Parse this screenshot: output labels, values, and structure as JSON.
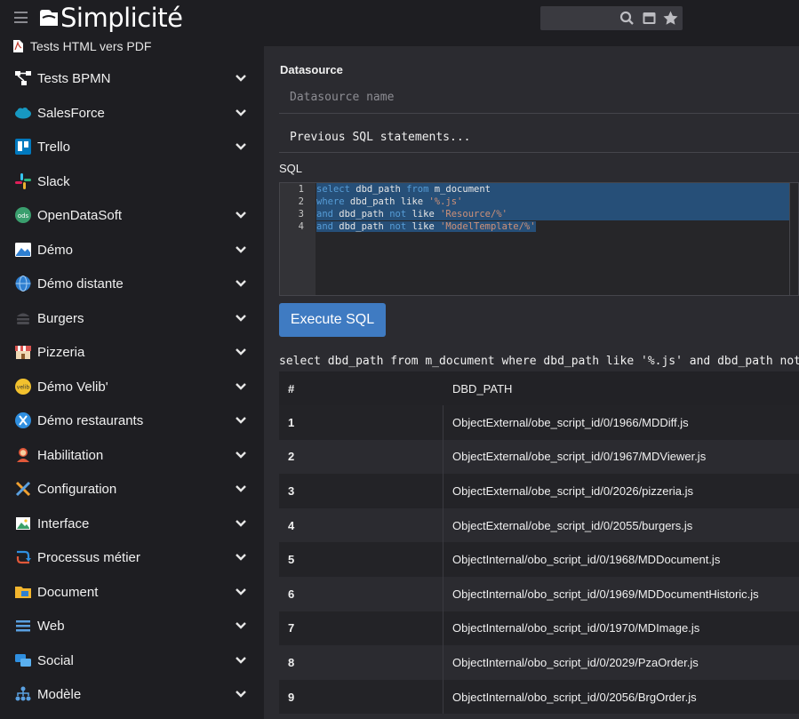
{
  "app": {
    "logo_text": "Simplicité"
  },
  "search": {
    "placeholder": ""
  },
  "sidebar": {
    "current": "Tests HTML vers PDF",
    "items": [
      {
        "label": "Tests BPMN",
        "icon": "bpmn-icon",
        "expandable": true
      },
      {
        "label": "SalesForce",
        "icon": "salesforce-icon",
        "expandable": true
      },
      {
        "label": "Trello",
        "icon": "trello-icon",
        "expandable": true
      },
      {
        "label": "Slack",
        "icon": "slack-icon",
        "expandable": false
      },
      {
        "label": "OpenDataSoft",
        "icon": "opendatasoft-icon",
        "expandable": true
      },
      {
        "label": "Démo",
        "icon": "demo-icon",
        "expandable": true
      },
      {
        "label": "Démo distante",
        "icon": "globe-icon",
        "expandable": true
      },
      {
        "label": "Burgers",
        "icon": "burger-icon",
        "expandable": true
      },
      {
        "label": "Pizzeria",
        "icon": "shop-icon",
        "expandable": true
      },
      {
        "label": "Démo Velib'",
        "icon": "velib-icon",
        "expandable": true
      },
      {
        "label": "Démo restaurants",
        "icon": "restaurant-icon",
        "expandable": true
      },
      {
        "label": "Habilitation",
        "icon": "user-icon",
        "expandable": true
      },
      {
        "label": "Configuration",
        "icon": "tools-icon",
        "expandable": true
      },
      {
        "label": "Interface",
        "icon": "image-icon",
        "expandable": true
      },
      {
        "label": "Processus métier",
        "icon": "process-icon",
        "expandable": true
      },
      {
        "label": "Document",
        "icon": "folder-icon",
        "expandable": true
      },
      {
        "label": "Web",
        "icon": "web-icon",
        "expandable": true
      },
      {
        "label": "Social",
        "icon": "chat-icon",
        "expandable": true
      },
      {
        "label": "Modèle",
        "icon": "hierarchy-icon",
        "expandable": true
      }
    ]
  },
  "main": {
    "datasource_label": "Datasource",
    "datasource_placeholder": "Datasource name",
    "previous_sql": "Previous SQL statements...",
    "sql_label": "SQL",
    "line_numbers": [
      "1",
      "2",
      "3",
      "4"
    ],
    "code": {
      "l1": {
        "k1": "select",
        "i1": " dbd_path ",
        "k2": "from",
        "i2": " m_document"
      },
      "l2": {
        "k1": "where",
        "i1": " dbd_path ",
        "k2": "like",
        "s1": " '%.js'"
      },
      "l3": {
        "k1": "and",
        "i1": " dbd_path ",
        "k2": "not",
        "k3": " like",
        "s1": " 'Resource/%'"
      },
      "l4": {
        "k1": "and",
        "i1": " dbd_path ",
        "k2": "not",
        "k3": " like",
        "s1": " 'ModelTemplate/%'"
      }
    },
    "execute_label": "Execute SQL",
    "query_echo": "select dbd_path from m_document where dbd_path like '%.js' and dbd_path not like 'Resource/%' and dbd_path not like 'ModelTemplate/%'",
    "table": {
      "headers": [
        "#",
        "DBD_PATH"
      ],
      "rows": [
        [
          "1",
          "ObjectExternal/obe_script_id/0/1966/MDDiff.js"
        ],
        [
          "2",
          "ObjectExternal/obe_script_id/0/1967/MDViewer.js"
        ],
        [
          "3",
          "ObjectExternal/obe_script_id/0/2026/pizzeria.js"
        ],
        [
          "4",
          "ObjectExternal/obe_script_id/0/2055/burgers.js"
        ],
        [
          "5",
          "ObjectInternal/obo_script_id/0/1968/MDDocument.js"
        ],
        [
          "6",
          "ObjectInternal/obo_script_id/0/1969/MDDocumentHistoric.js"
        ],
        [
          "7",
          "ObjectInternal/obo_script_id/0/1970/MDImage.js"
        ],
        [
          "8",
          "ObjectInternal/obo_script_id/0/2029/PzaOrder.js"
        ],
        [
          "9",
          "ObjectInternal/obo_script_id/0/2056/BrgOrder.js"
        ]
      ]
    }
  },
  "colors": {
    "accent": "#3f7bc2",
    "selection": "#264f78",
    "keyword": "#569cd6",
    "string": "#ce9178"
  }
}
